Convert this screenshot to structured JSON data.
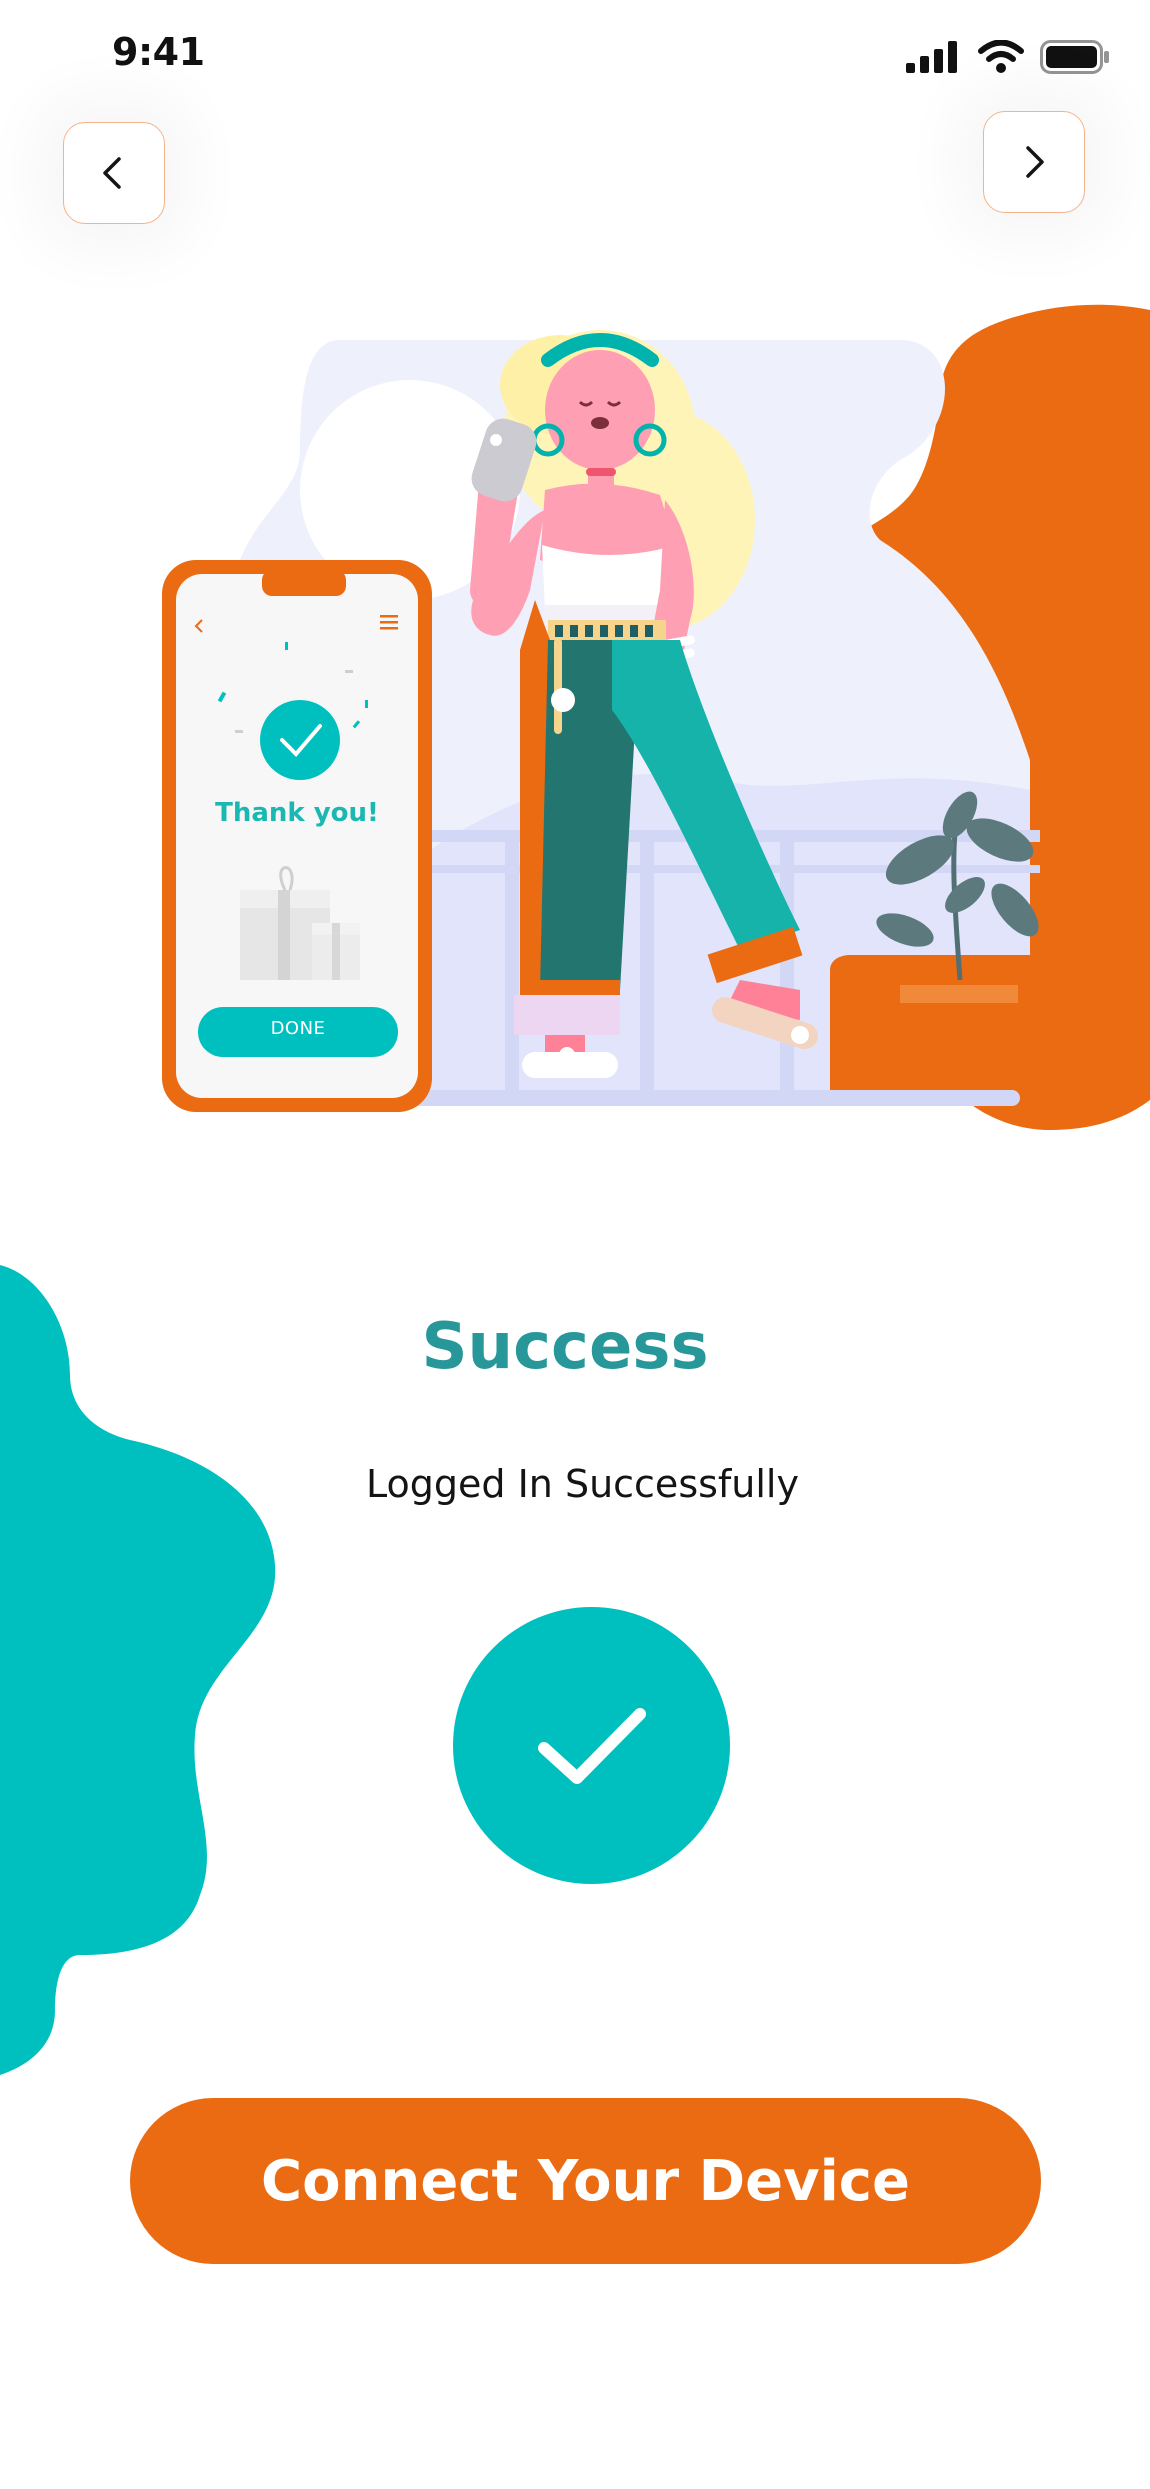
{
  "status_bar": {
    "time": "9:41",
    "icons": [
      "signal-icon",
      "wifi-icon",
      "battery-icon"
    ]
  },
  "nav": {
    "back_icon": "chevron-left-icon",
    "forward_icon": "chevron-right-icon"
  },
  "illustration": {
    "phone_screen": {
      "message": "Thank you!",
      "button_label": "DONE"
    }
  },
  "content": {
    "title": "Success",
    "subtitle": "Logged In Successfully",
    "status_icon": "checkmark-icon"
  },
  "cta": {
    "label": "Connect Your Device"
  },
  "colors": {
    "accent_orange": "#eb6b12",
    "accent_teal": "#00c0bf",
    "title_teal": "#27979a",
    "text_dark": "#141414"
  }
}
